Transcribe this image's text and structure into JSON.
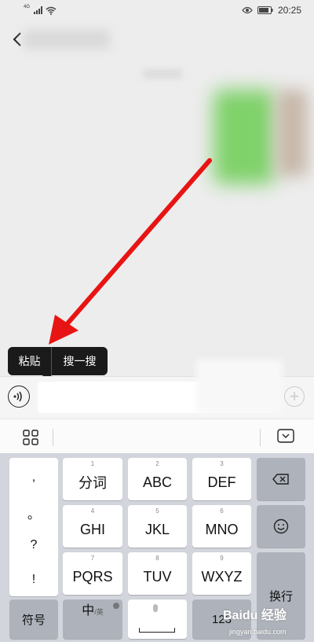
{
  "status_bar": {
    "network": "4G",
    "time": "20:25"
  },
  "context_menu": {
    "paste": "粘贴",
    "search": "搜一搜"
  },
  "keyboard": {
    "punctuation": [
      ",",
      "。",
      "?",
      "!"
    ],
    "keys": [
      {
        "num": "1",
        "label": "分词"
      },
      {
        "num": "2",
        "label": "ABC"
      },
      {
        "num": "3",
        "label": "DEF"
      },
      {
        "num": "4",
        "label": "GHI"
      },
      {
        "num": "5",
        "label": "JKL"
      },
      {
        "num": "6",
        "label": "MNO"
      },
      {
        "num": "7",
        "label": "PQRS"
      },
      {
        "num": "8",
        "label": "TUV"
      },
      {
        "num": "9",
        "label": "WXYZ"
      }
    ],
    "symbol_key": "符号",
    "lang_key_main": "中",
    "lang_key_sub": "/英",
    "enter_key": "换行",
    "number_key": "123"
  },
  "watermark": {
    "main": "Baidu 经验",
    "sub": "jingyan.baidu.com"
  },
  "colors": {
    "arrow": "#e81414",
    "keyboard_bg": "#d2d5db",
    "chat_bg": "#ededed"
  }
}
